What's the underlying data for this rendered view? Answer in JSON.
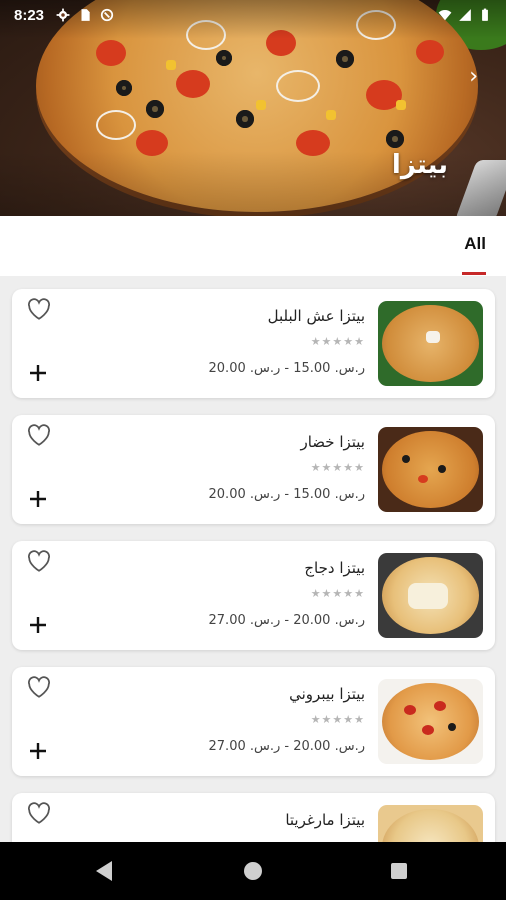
{
  "status_bar": {
    "time": "8:23"
  },
  "header": {
    "title": "بيتزا"
  },
  "tabs": [
    {
      "label": "All",
      "active": true
    }
  ],
  "products": [
    {
      "name": "بيتزا عش البلبل",
      "price": "ر.س. 15.00 - ر.س. 20.00",
      "rating": "★★★★★"
    },
    {
      "name": "بيتزا خضار",
      "price": "ر.س. 15.00 - ر.س. 20.00",
      "rating": "★★★★★"
    },
    {
      "name": "بيتزا دجاج",
      "price": "ر.س. 20.00 - ر.س. 27.00",
      "rating": "★★★★★"
    },
    {
      "name": "بيتزا بيبروني",
      "price": "ر.س. 20.00 - ر.س. 27.00",
      "rating": "★★★★★"
    },
    {
      "name": "بيتزا مارغريتا",
      "price": "",
      "rating": ""
    }
  ],
  "colors": {
    "accent": "#c62828",
    "background": "#eeeeee",
    "card": "#ffffff"
  }
}
